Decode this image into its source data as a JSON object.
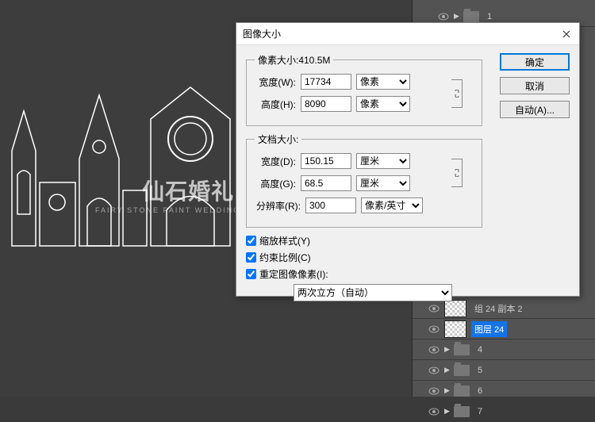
{
  "dialog": {
    "title": "图像大小",
    "pixelDimensions": {
      "legend": "像素大小:410.5M",
      "widthLabel": "宽度(W):",
      "widthValue": "17734",
      "widthUnit": "像素",
      "heightLabel": "高度(H):",
      "heightValue": "8090",
      "heightUnit": "像素"
    },
    "documentSize": {
      "legend": "文档大小:",
      "widthLabel": "宽度(D):",
      "widthValue": "150.15",
      "widthUnit": "厘米",
      "heightLabel": "高度(G):",
      "heightValue": "68.5",
      "heightUnit": "厘米",
      "resolutionLabel": "分辨率(R):",
      "resolutionValue": "300",
      "resolutionUnit": "像素/英寸"
    },
    "checkboxes": {
      "scaleStyles": "缩放样式(Y)",
      "constrainProportions": "约束比例(C)",
      "resampleImage": "重定图像像素(I):"
    },
    "resampleMethod": "两次立方（自动）",
    "buttons": {
      "ok": "确定",
      "cancel": "取消",
      "auto": "自动(A)..."
    }
  },
  "layers": {
    "items": [
      {
        "type": "folder",
        "name": "1",
        "indent": 2,
        "eye": true
      },
      {
        "type": "layer",
        "name": "组 24 副本 2",
        "indent": 1,
        "eye": true,
        "thumb": true
      },
      {
        "type": "layer",
        "name": "图层 24",
        "indent": 1,
        "eye": true,
        "thumb": true,
        "selected": true
      },
      {
        "type": "folder",
        "name": "4",
        "indent": 1,
        "eye": true
      },
      {
        "type": "folder",
        "name": "5",
        "indent": 1,
        "eye": true
      },
      {
        "type": "folder",
        "name": "6",
        "indent": 1,
        "eye": true
      },
      {
        "type": "folder",
        "name": "7",
        "indent": 1,
        "eye": true
      }
    ]
  },
  "watermark": {
    "cn": "仙石婚礼",
    "en": "FAIRY STONE PAINT WEDDING DESIGN"
  }
}
